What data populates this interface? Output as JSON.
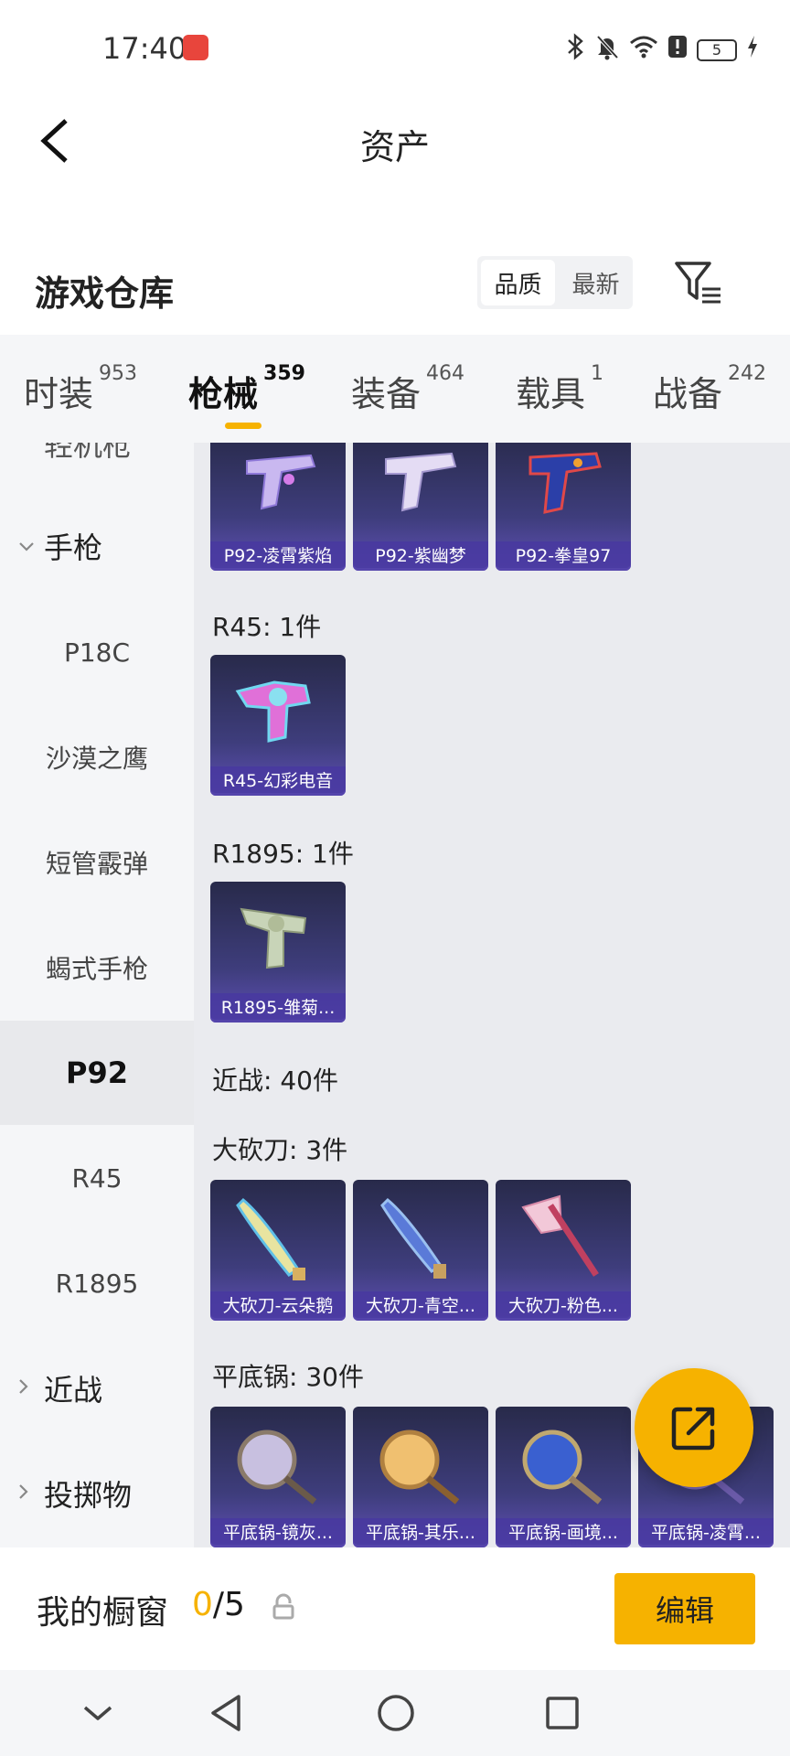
{
  "status_bar": {
    "time": "17:40",
    "battery": "5"
  },
  "header": {
    "title": "资产"
  },
  "section": {
    "title": "游戏仓库",
    "sort_options": [
      "品质",
      "最新"
    ],
    "active_sort": "品质"
  },
  "tabs": [
    {
      "label": "时装",
      "count": "953"
    },
    {
      "label": "枪械",
      "count": "359"
    },
    {
      "label": "装备",
      "count": "464"
    },
    {
      "label": "载具",
      "count": "1"
    },
    {
      "label": "战备",
      "count": "242"
    }
  ],
  "active_tab": "枪械",
  "sidebar": {
    "partial_top": "轻机枪",
    "group_pistol": "手枪",
    "items": [
      "P18C",
      "沙漠之鹰",
      "短管霰弹",
      "蝎式手枪",
      "P92",
      "R45",
      "R1895"
    ],
    "active_item": "P92",
    "group_melee": "近战",
    "group_throw": "投掷物"
  },
  "content": {
    "p92_cards": [
      "P92-凌霄紫焰",
      "P92-紫幽梦",
      "P92-拳皇97"
    ],
    "r45_label": "R45: 1件",
    "r45_cards": [
      "R45-幻彩电音"
    ],
    "r1895_label": "R1895: 1件",
    "r1895_cards": [
      "R1895-雏菊..."
    ],
    "melee_label": "近战: 40件",
    "machete_label": "大砍刀: 3件",
    "machete_cards": [
      "大砍刀-云朵鹅",
      "大砍刀-青空...",
      "大砍刀-粉色..."
    ],
    "pan_label": "平底锅: 30件",
    "pan_cards": [
      "平底锅-镜灰...",
      "平底锅-其乐...",
      "平底锅-画境...",
      "平底锅-凌霄..."
    ]
  },
  "bottom_bar": {
    "window_label": "我的橱窗",
    "current": "0",
    "total": "/5",
    "edit_label": "编辑"
  },
  "colors": {
    "accent": "#f6b200",
    "card_purple": "#4838a0"
  }
}
